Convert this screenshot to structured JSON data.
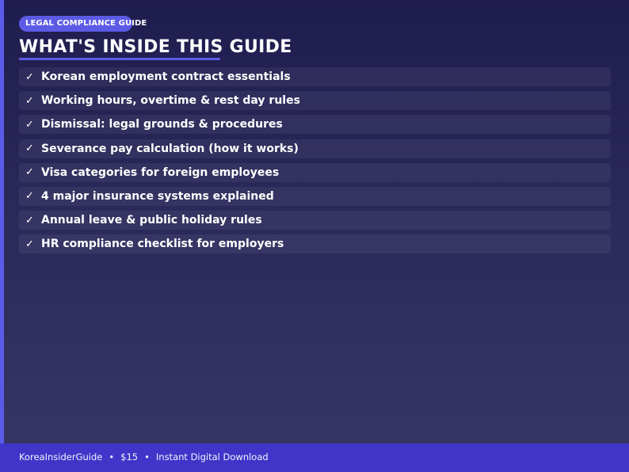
{
  "badge": "LEGAL COMPLIANCE GUIDE",
  "title": "WHAT'S INSIDE THIS GUIDE",
  "check_glyph": "✓",
  "items": [
    "Korean employment contract essentials",
    "Working hours, overtime & rest day rules",
    "Dismissal: legal grounds & procedures",
    "Severance pay calculation (how it works)",
    "Visa categories for foreign employees",
    "4 major insurance systems explained",
    "Annual leave & public holiday rules",
    "HR compliance checklist for employers"
  ],
  "footer": {
    "brand": "KoreaInsiderGuide",
    "separator": "•",
    "price": "$15",
    "delivery": "Instant Digital Download"
  },
  "colors": {
    "accent": "#5b5be6",
    "footer_bg": "#4035c8",
    "background_top": "#1f1c4f",
    "background_bottom": "#383666"
  }
}
